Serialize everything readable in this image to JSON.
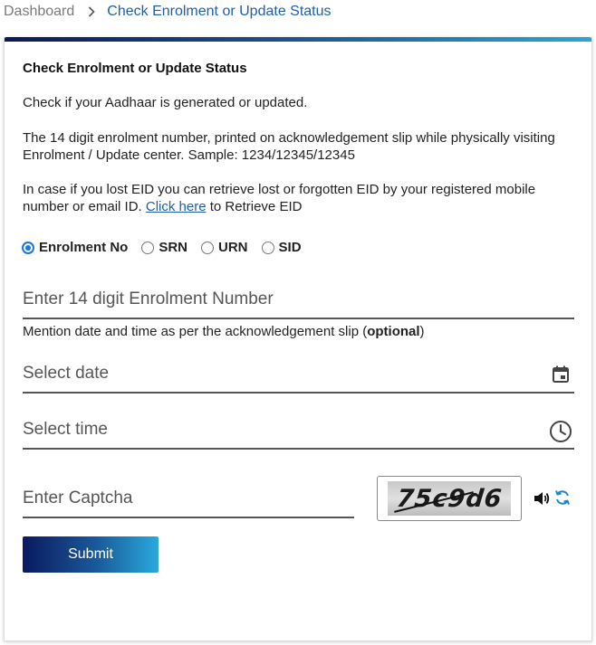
{
  "breadcrumb": {
    "home": "Dashboard",
    "current": "Check Enrolment or Update Status"
  },
  "card": {
    "title": "Check Enrolment or Update Status",
    "intro": "Check if your Aadhaar is generated or updated.",
    "enrolment_info": "The 14 digit enrolment number, printed on acknowledgement slip while physically visiting Enrolment / Update center. Sample: 1234/12345/12345",
    "lost_eid_prefix": "In case if you lost EID you can retrieve lost or forgotten EID by your registered mobile number or email ID. ",
    "lost_eid_link": "Click here",
    "lost_eid_suffix": " to Retrieve EID"
  },
  "id_type": {
    "options": [
      "Enrolment No",
      "SRN",
      "URN",
      "SID"
    ],
    "selected": "Enrolment No"
  },
  "form": {
    "enrolment_placeholder": "Enter 14 digit Enrolment Number",
    "hint_prefix": "Mention date and time as per the acknowledgement slip (",
    "hint_bold": "optional",
    "hint_suffix": ")",
    "date_placeholder": "Select date",
    "time_placeholder": "Select time",
    "captcha_placeholder": "Enter Captcha",
    "captcha_text": "75c9d6",
    "submit_label": "Submit"
  },
  "colors": {
    "link": "#1f5fa6",
    "radio_accent": "#1a73e8",
    "button_gradient_start": "#0a1a5e",
    "button_gradient_end": "#2aa9dc"
  },
  "icons": {
    "breadcrumb_separator": "chevron-right-icon",
    "date": "calendar-icon",
    "time": "clock-icon",
    "captcha_audio": "speaker-icon",
    "captcha_refresh": "refresh-icon"
  }
}
